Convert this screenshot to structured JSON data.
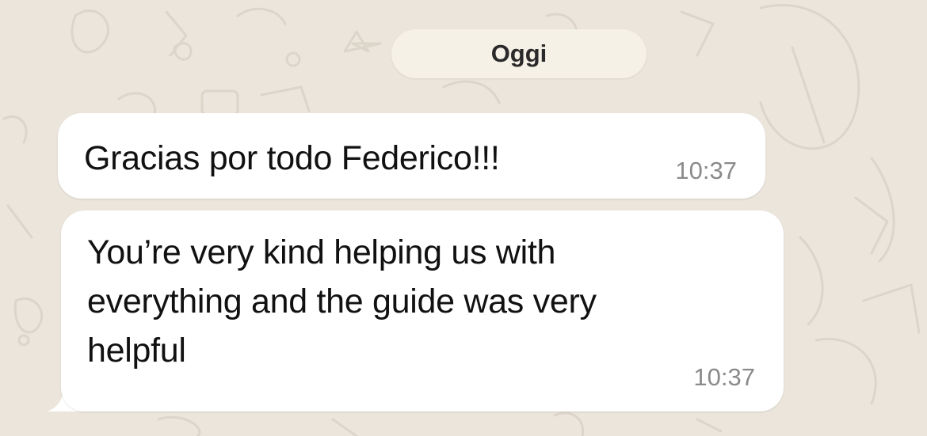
{
  "chat": {
    "date_label": "Oggi",
    "messages": [
      {
        "text": "Gracias por todo Federico!!!",
        "time": "10:37"
      },
      {
        "text": "You’re very kind helping us with\neverything and the guide was very\nhelpful",
        "time": "10:37"
      }
    ]
  },
  "colors": {
    "background": "#ebe5dc",
    "bubble": "#ffffff",
    "date_chip": "#f6f1e7",
    "timestamp": "#8a8a8a"
  }
}
